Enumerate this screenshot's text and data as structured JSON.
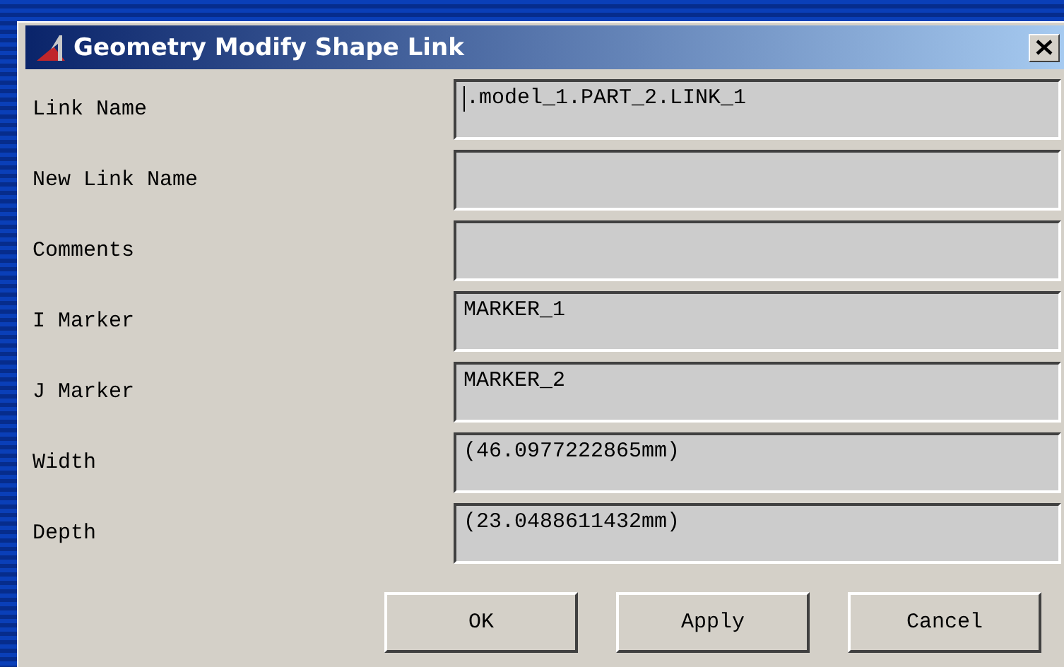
{
  "window": {
    "title": "Geometry Modify Shape Link"
  },
  "fields": [
    {
      "label": "Link Name",
      "value": ".model_1.PART_2.LINK_1",
      "focused": true
    },
    {
      "label": "New Link Name",
      "focused": false
    },
    {
      "label": "Comments",
      "focused": false
    },
    {
      "label": "I Marker",
      "value": "MARKER_1",
      "focused": false
    },
    {
      "label": "J Marker",
      "value": "MARKER_2",
      "focused": false
    },
    {
      "label": "Width",
      "value": "(46.0977222865mm)",
      "focused": false
    },
    {
      "label": "Depth",
      "value": "(23.0488611432mm)",
      "focused": false
    }
  ],
  "buttons": [
    "OK",
    "Apply",
    "Cancel"
  ]
}
